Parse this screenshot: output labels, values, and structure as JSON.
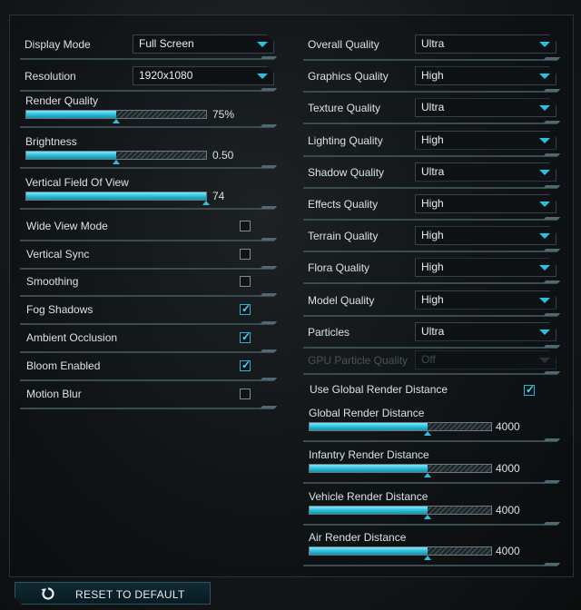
{
  "left": {
    "dropdowns": [
      {
        "label": "Display Mode",
        "value": "Full Screen"
      },
      {
        "label": "Resolution",
        "value": "1920x1080"
      }
    ],
    "sliders": [
      {
        "label": "Render Quality",
        "value": "75%",
        "level": 0.5
      },
      {
        "label": "Brightness",
        "value": "0.50",
        "level": 0.5
      },
      {
        "label": "Vertical Field Of View",
        "value": "74",
        "level": 1.0
      }
    ],
    "checkboxes": [
      {
        "label": "Wide View Mode",
        "checked": false
      },
      {
        "label": "Vertical Sync",
        "checked": false
      },
      {
        "label": "Smoothing",
        "checked": false
      },
      {
        "label": "Fog Shadows",
        "checked": true
      },
      {
        "label": "Ambient Occlusion",
        "checked": true
      },
      {
        "label": "Bloom Enabled",
        "checked": true
      },
      {
        "label": "Motion Blur",
        "checked": false
      }
    ]
  },
  "right": {
    "dropdowns": [
      {
        "label": "Overall Quality",
        "value": "Ultra"
      },
      {
        "label": "Graphics Quality",
        "value": "High"
      },
      {
        "label": "Texture Quality",
        "value": "Ultra"
      },
      {
        "label": "Lighting Quality",
        "value": "High"
      },
      {
        "label": "Shadow Quality",
        "value": "Ultra"
      },
      {
        "label": "Effects Quality",
        "value": "High"
      },
      {
        "label": "Terrain Quality",
        "value": "High"
      },
      {
        "label": "Flora Quality",
        "value": "High"
      },
      {
        "label": "Model Quality",
        "value": "High"
      },
      {
        "label": "Particles",
        "value": "Ultra"
      }
    ],
    "gpu_particle": {
      "label": "GPU Particle Quality",
      "value": "Off"
    },
    "global_toggle": {
      "label": "Use Global Render Distance",
      "checked": true
    },
    "sliders": [
      {
        "label": "Global Render Distance",
        "value": "4000",
        "level": 0.65
      },
      {
        "label": "Infantry Render Distance",
        "value": "4000",
        "level": 0.65
      },
      {
        "label": "Vehicle Render Distance",
        "value": "4000",
        "level": 0.65
      },
      {
        "label": "Air Render Distance",
        "value": "4000",
        "level": 0.65
      }
    ]
  },
  "reset_label": "RESET TO DEFAULT",
  "colors": {
    "accent": "#2dc0de",
    "fill_light": "#7ee8f8",
    "background": "#15181a"
  }
}
